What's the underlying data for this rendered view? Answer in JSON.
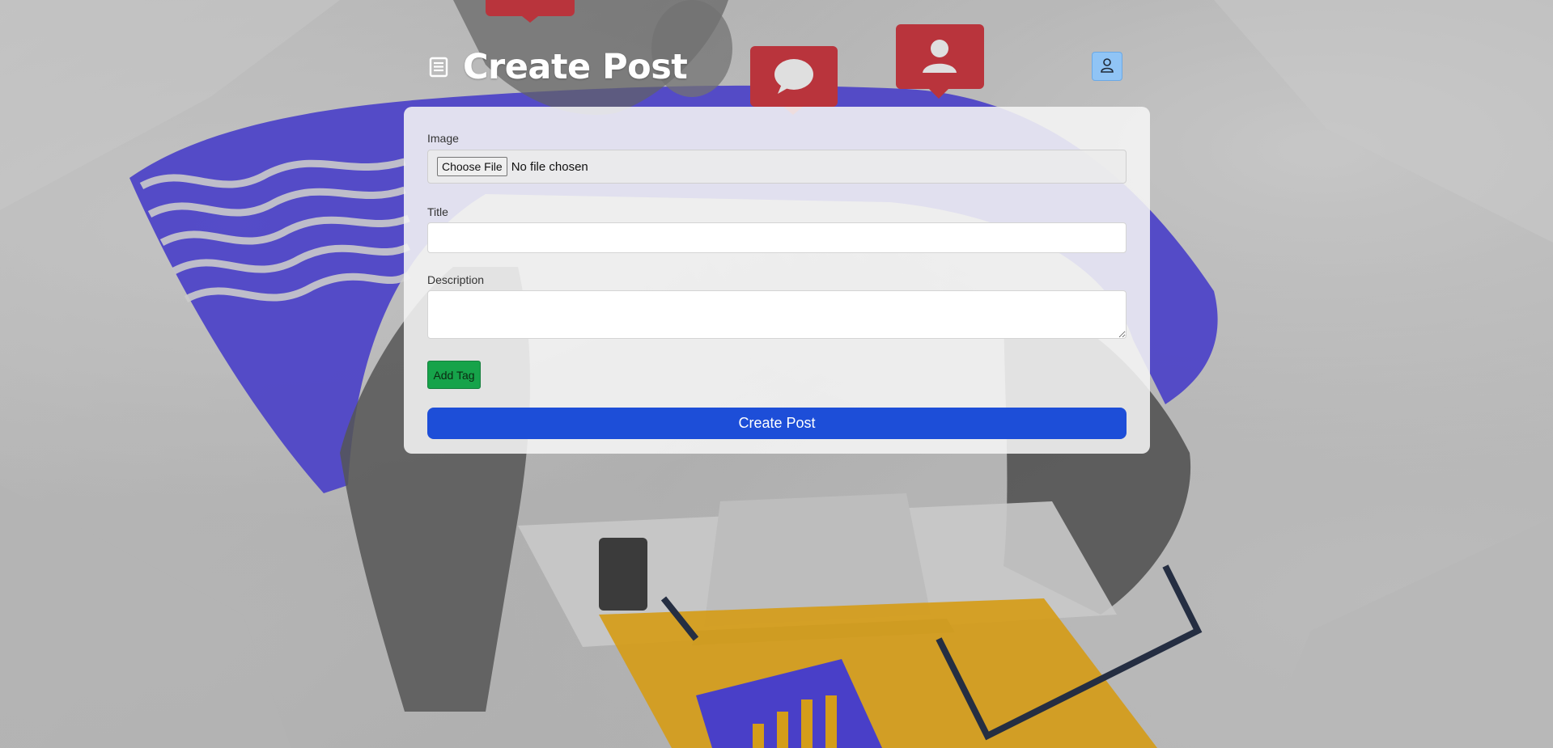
{
  "header": {
    "title": "Create Post",
    "title_icon": "document-icon",
    "profile_icon": "user-icon"
  },
  "form": {
    "image_label": "Image",
    "file_button_label": "Choose File",
    "file_status": "No file chosen",
    "title_label": "Title",
    "title_value": "",
    "description_label": "Description",
    "description_value": "",
    "add_tag_label": "Add Tag",
    "submit_label": "Create Post"
  },
  "colors": {
    "primary": "#1d4ed8",
    "success": "#16a34a",
    "profile_button": "#90c4f5",
    "accent_blue_shape": "#3b2fd6",
    "accent_yellow_shape": "#e5a100",
    "notification_red": "#c4212b"
  }
}
